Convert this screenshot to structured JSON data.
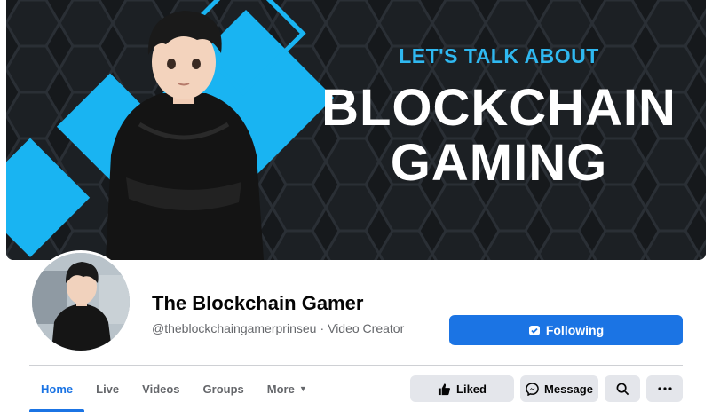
{
  "cover": {
    "kicker": "LET'S TALK ABOUT",
    "headline_line1": "BLOCKCHAIN",
    "headline_line2": "GAMING",
    "accent_color": "#2fb8f0",
    "background_color": "#16191c"
  },
  "profile": {
    "name": "The Blockchain Gamer",
    "handle": "@theblockchaingamerprinseu",
    "separator": "·",
    "category": "Video Creator",
    "following_label": "Following"
  },
  "tabs": [
    {
      "label": "Home",
      "active": true
    },
    {
      "label": "Live",
      "active": false
    },
    {
      "label": "Videos",
      "active": false
    },
    {
      "label": "Groups",
      "active": false
    },
    {
      "label": "More",
      "active": false
    }
  ],
  "actions": {
    "liked_label": "Liked",
    "message_label": "Message"
  },
  "colors": {
    "primary": "#1b74e4",
    "secondary_button": "#e4e6eb",
    "muted_text": "#65676b"
  }
}
